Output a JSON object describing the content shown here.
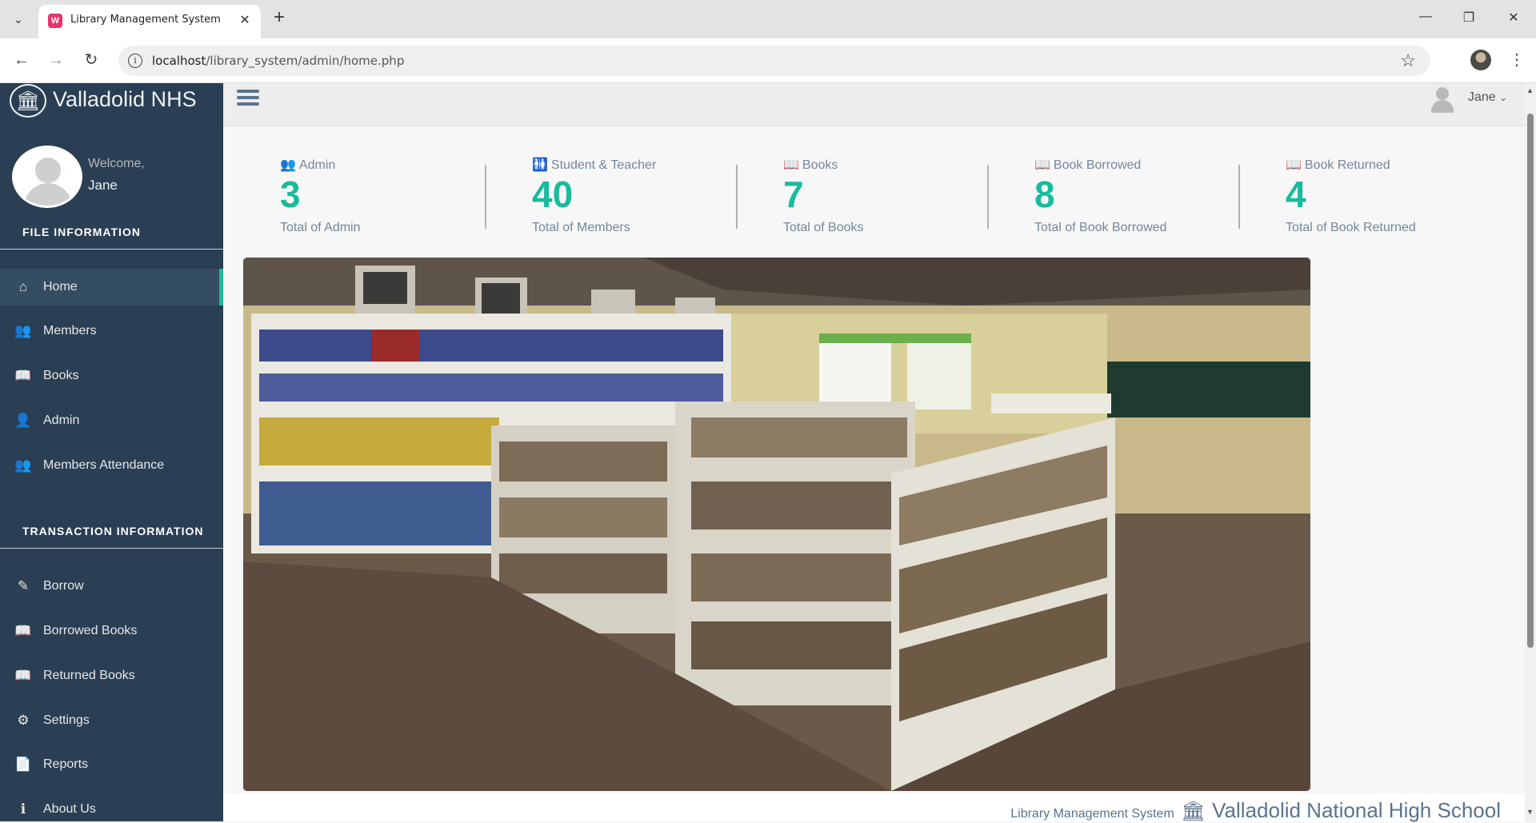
{
  "browser": {
    "tab_title": "Library Management System",
    "tab_favicon_letter": "W",
    "url_host": "localhost",
    "url_path": "/library_system/admin/home.php",
    "icons": {
      "back": "back-arrow-icon",
      "forward": "forward-arrow-icon",
      "reload": "reload-icon",
      "bookmark": "star-icon",
      "menu": "kebab-menu-icon"
    }
  },
  "sidebar": {
    "brand": "Valladolid NHS",
    "welcome": "Welcome,",
    "user_name": "Jane",
    "section_file": "FILE INFORMATION",
    "section_transaction": "TRANSACTION INFORMATION",
    "file_items": [
      {
        "label": "Home",
        "icon": "home-icon",
        "active": true
      },
      {
        "label": "Members",
        "icon": "users-icon"
      },
      {
        "label": "Books",
        "icon": "book-icon"
      },
      {
        "label": "Admin",
        "icon": "user-icon"
      },
      {
        "label": "Members Attendance",
        "icon": "users-icon"
      }
    ],
    "transaction_items": [
      {
        "label": "Borrow",
        "icon": "edit-icon"
      },
      {
        "label": "Borrowed Books",
        "icon": "book-icon"
      },
      {
        "label": "Returned Books",
        "icon": "book-icon"
      },
      {
        "label": "Settings",
        "icon": "gear-icon"
      },
      {
        "label": "Reports",
        "icon": "file-icon"
      },
      {
        "label": "About Us",
        "icon": "info-icon"
      }
    ]
  },
  "topnav": {
    "user_name": "Jane"
  },
  "tiles": [
    {
      "title": "Admin",
      "count": "3",
      "bottom": "Total of Admin",
      "icon": "users-icon"
    },
    {
      "title": "Student & Teacher",
      "count": "40",
      "bottom": "Total of Members",
      "icon": "male-female-icon"
    },
    {
      "title": "Books",
      "count": "7",
      "bottom": "Total of Books",
      "icon": "book-icon"
    },
    {
      "title": "Book Borrowed",
      "count": "8",
      "bottom": "Total of Book Borrowed",
      "icon": "book-icon"
    },
    {
      "title": "Book Returned",
      "count": "4",
      "bottom": "Total of Book Returned",
      "icon": "book-icon"
    }
  ],
  "footer": {
    "system": "Library Management System",
    "school": "Valladolid National High School"
  },
  "colors": {
    "sidebar_bg": "#2a3f54",
    "accent": "#1ABB9C",
    "text_muted": "#73879C"
  }
}
